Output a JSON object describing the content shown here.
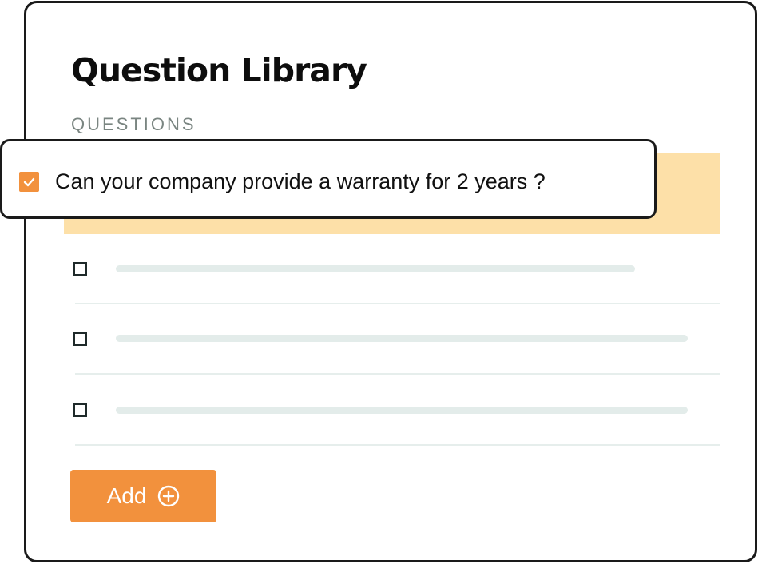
{
  "library": {
    "title": "Question Library",
    "section_label": "QUESTIONS"
  },
  "selected_question": {
    "text": "Can your company provide a warranty for 2 years ?",
    "checked": true
  },
  "question_rows": [
    {
      "checked": false
    },
    {
      "checked": false
    },
    {
      "checked": false
    }
  ],
  "actions": {
    "add_label": "Add"
  },
  "colors": {
    "accent": "#f2913d",
    "highlight": "#fde0a8",
    "placeholder": "#e3ecea",
    "border": "#1a1a1a",
    "section_label": "#7a8581"
  },
  "icons": {
    "checkmark": "checkmark-icon",
    "add": "plus-circle-icon"
  }
}
